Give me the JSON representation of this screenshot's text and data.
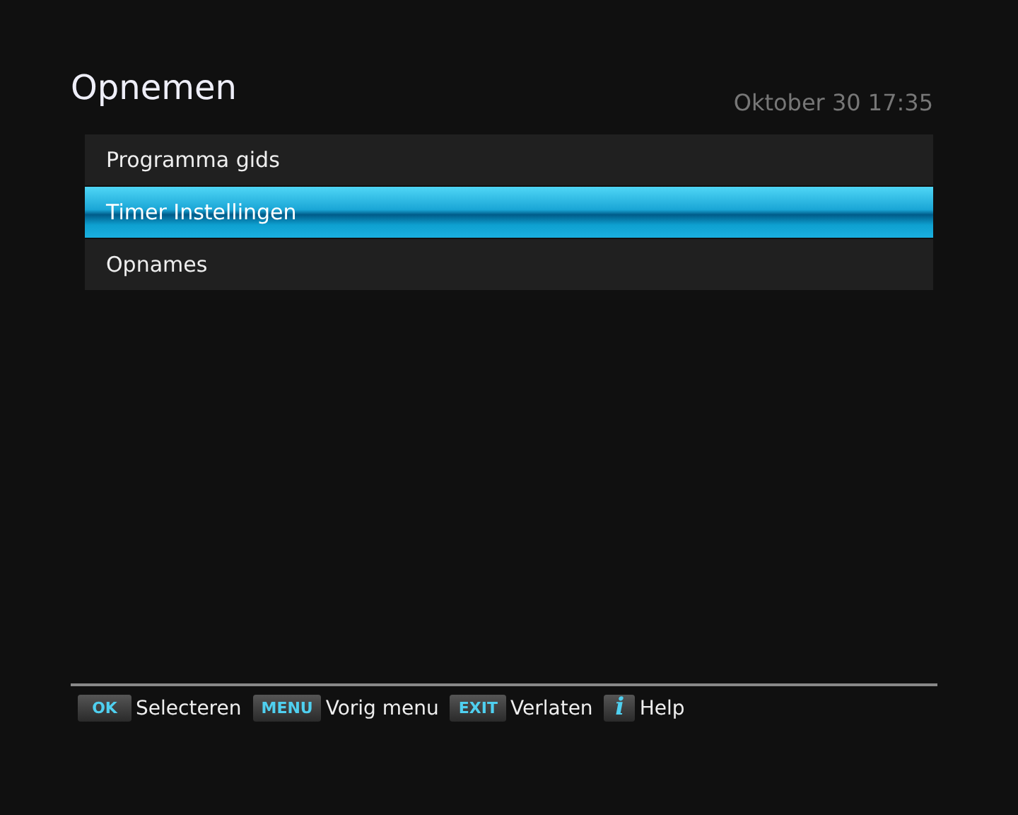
{
  "title": "Opnemen",
  "datetime": "Oktober 30 17:35",
  "menu": [
    {
      "label": "Programma gids",
      "selected": false
    },
    {
      "label": "Timer Instellingen",
      "selected": true
    },
    {
      "label": "Opnames",
      "selected": false
    }
  ],
  "hints": [
    {
      "key": "OK",
      "label": "Selecteren",
      "kind": "key"
    },
    {
      "key": "MENU",
      "label": "Vorig menu",
      "kind": "key"
    },
    {
      "key": "EXIT",
      "label": "Verlaten",
      "kind": "key"
    },
    {
      "key": "i",
      "label": "Help",
      "kind": "info"
    }
  ]
}
